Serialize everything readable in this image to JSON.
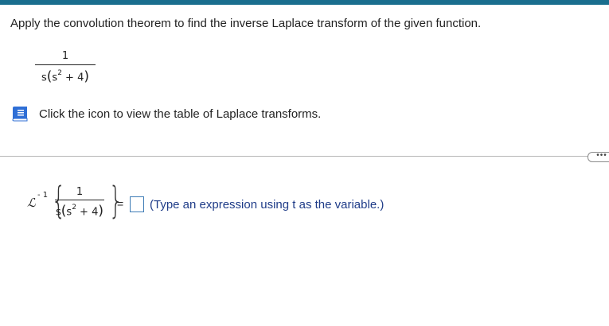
{
  "question": {
    "prompt": "Apply the convolution theorem to find the inverse Laplace transform of the given function."
  },
  "function": {
    "numerator": "1",
    "den_s": "s",
    "den_open": "(",
    "den_base": "s",
    "den_exp": "2",
    "den_rest": " + 4",
    "den_close": ")"
  },
  "table_link": {
    "icon": "book-icon",
    "label": "Click the icon to view the table of Laplace transforms."
  },
  "more_button": {
    "label": "•••"
  },
  "answer_row": {
    "operator": "ℒ",
    "operator_exp": "- 1",
    "brace_open": "{",
    "brace_close": "}",
    "numerator": "1",
    "den_s": "s",
    "den_open": "(",
    "den_base": "s",
    "den_exp": "2",
    "den_rest": " + 4",
    "den_close": ")",
    "equals": "=",
    "answer_value": "",
    "hint": "(Type an expression using t as the variable.)"
  },
  "colors": {
    "top_bar": "#1a6e8e",
    "hint_text": "#1f3c88",
    "answer_box_border": "#3d7bb5",
    "book_icon": "#2f6fd6"
  }
}
